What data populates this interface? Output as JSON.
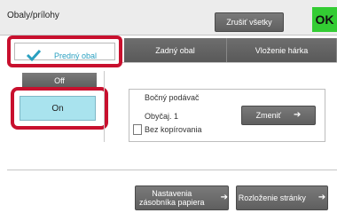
{
  "header": {
    "title": "Obaly/prílohy",
    "clear_all": "Zrušiť všetky",
    "ok": "OK"
  },
  "tabs": {
    "active": "Predný obal",
    "items": [
      "Zadný obal",
      "Vloženie hárka"
    ]
  },
  "toggle": {
    "off": "Off",
    "on": "On"
  },
  "settings": {
    "feeder": "Bočný podávač",
    "paper": "Obyčaj. 1",
    "copy_mode": "Bez kopírovania",
    "change_button": "Zmeniť"
  },
  "footer": {
    "tray_settings": "Nastavenia zásobníka papiera",
    "layout": "Rozloženie stránky"
  },
  "colors": {
    "highlight": "#c8102e",
    "accent": "#33cc33",
    "on_button": "#a9e3ee"
  },
  "icons": {
    "check": "check-icon",
    "arrow": "arrow-right-icon"
  }
}
